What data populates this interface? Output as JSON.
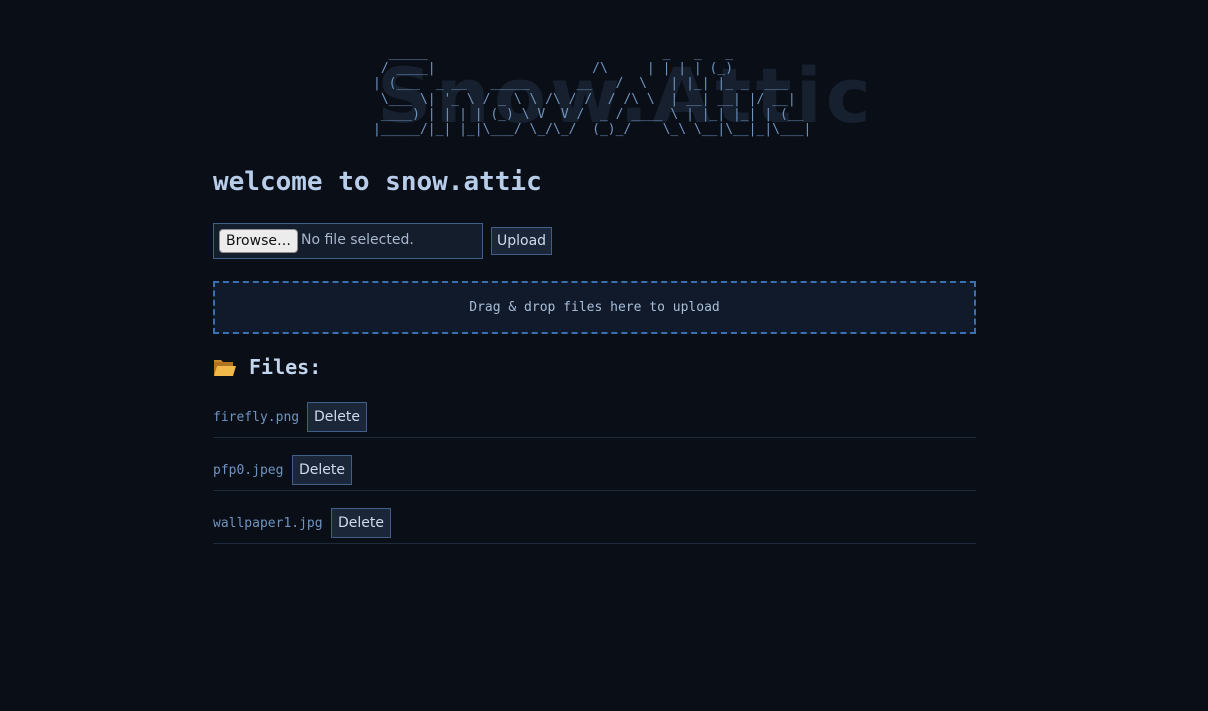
{
  "header": {
    "ascii_art": "  _____                              _   _   _      \n / ____|                    /\\     | | | | (_)     \n| (___  _ __   _____      __   /  \\   | |_| |_ _  ___ \n \\___ \\| '_ \\ / _ \\ \\ /\\ / /  / /\\ \\  | __| __| |/ __|\n ____) | | | | (_) \\ V  V /  _ / ____ \\ | |_| |_| | (__ \n|_____/|_| |_|\\___/ \\_/\\_/  (_)_/    \\_\\ \\__|\\__|_|\\___|",
    "ascii_ghost_text": "Snow.Attic",
    "title": "welcome to snow.attic"
  },
  "upload": {
    "browse_label": "Browse…",
    "file_status": "No file selected.",
    "upload_label": "Upload"
  },
  "dropzone": {
    "text": "Drag & drop files here to upload"
  },
  "files": {
    "heading": "Files:",
    "icon": "open-folder-icon",
    "items": [
      {
        "name": "firefly.png",
        "delete_label": "Delete"
      },
      {
        "name": "pfp0.jpeg",
        "delete_label": "Delete"
      },
      {
        "name": "wallpaper1.jpg",
        "delete_label": "Delete"
      }
    ]
  }
}
